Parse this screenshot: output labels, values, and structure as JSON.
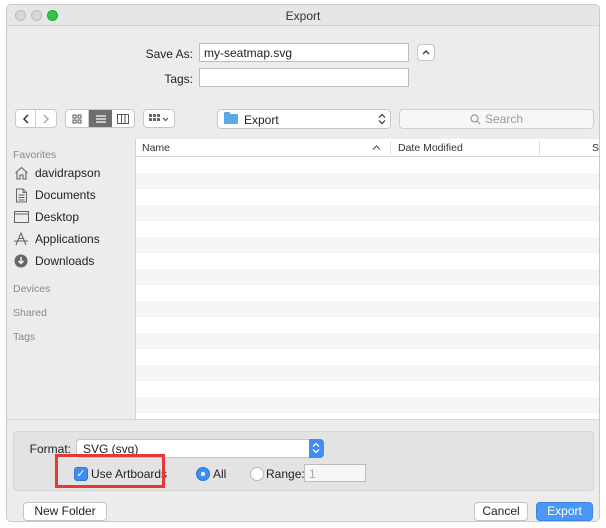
{
  "window": {
    "title": "Export"
  },
  "save": {
    "save_as_label": "Save As:",
    "filename": "my-seatmap.svg",
    "tags_label": "Tags:",
    "tags_value": ""
  },
  "toolbar": {
    "back_icon": "chevron-left",
    "forward_icon": "chevron-right",
    "views": [
      "icon-view",
      "list-view",
      "column-view",
      "gallery-view"
    ],
    "selected_view": "list-view",
    "location": "Export",
    "search_placeholder": "Search"
  },
  "sidebar": {
    "favorites_header": "Favorites",
    "favorites": [
      {
        "label": "davidrapson",
        "icon": "home-icon"
      },
      {
        "label": "Documents",
        "icon": "documents-icon"
      },
      {
        "label": "Desktop",
        "icon": "desktop-icon"
      },
      {
        "label": "Applications",
        "icon": "applications-icon"
      },
      {
        "label": "Downloads",
        "icon": "downloads-icon"
      }
    ],
    "devices_header": "Devices",
    "shared_header": "Shared",
    "tags_header": "Tags"
  },
  "filelist": {
    "columns": [
      "Name",
      "Date Modified",
      "Siz"
    ],
    "sort_indicator": "^"
  },
  "options": {
    "format_label": "Format:",
    "format_value": "SVG (svg)",
    "use_artboards_label": "Use Artboards",
    "use_artboards_checked": true,
    "all_label": "All",
    "range_label": "Range:",
    "range_value": "1"
  },
  "buttons": {
    "new_folder": "New Folder",
    "cancel": "Cancel",
    "export": "Export"
  },
  "colors": {
    "accent": "#3d8df5",
    "highlight": "#e53935"
  }
}
